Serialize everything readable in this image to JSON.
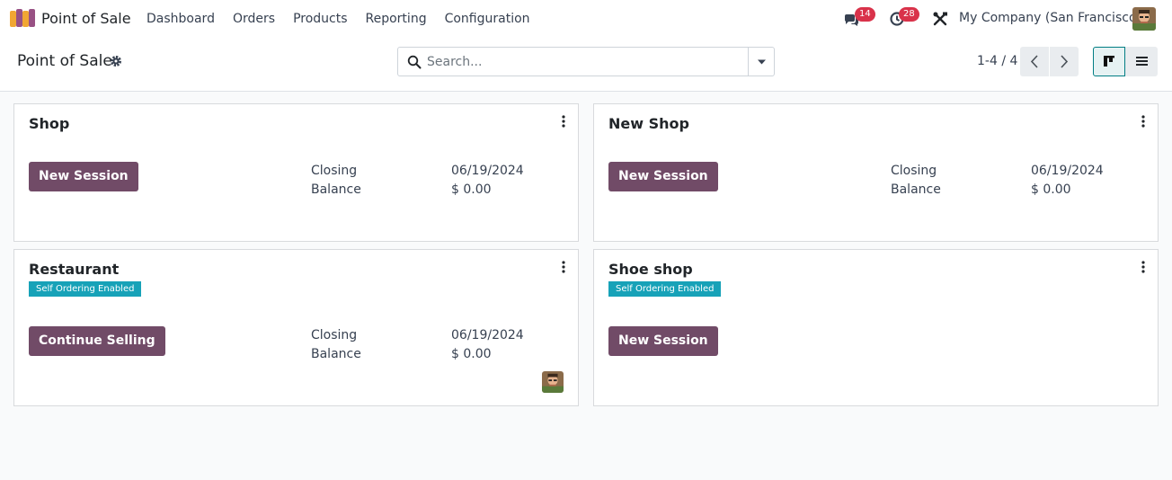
{
  "navbar": {
    "app_name": "Point of Sale",
    "menu": [
      "Dashboard",
      "Orders",
      "Products",
      "Reporting",
      "Configuration"
    ],
    "messages_count": "14",
    "activities_count": "28",
    "company": "My Company (San Francisco)",
    "icons": {
      "app": "pos-app-icon",
      "messages": "chat-icon",
      "activities": "clock-icon",
      "debug": "tools-icon",
      "user": "user-avatar"
    }
  },
  "control_panel": {
    "breadcrumb": "Point of Sale",
    "search_placeholder": "Search...",
    "pager": "1-4 / 4"
  },
  "cards": [
    {
      "title": "Shop",
      "tag": "",
      "button": "New Session",
      "closing_label": "Closing",
      "closing_value": "06/19/2024",
      "balance_label": "Balance",
      "balance_value": "$ 0.00"
    },
    {
      "title": "New Shop",
      "tag": "",
      "button": "New Session",
      "closing_label": "Closing",
      "closing_value": "06/19/2024",
      "balance_label": "Balance",
      "balance_value": "$ 0.00"
    },
    {
      "title": "Restaurant",
      "tag": "Self Ordering Enabled",
      "button": "Continue Selling",
      "closing_label": "Closing",
      "closing_value": "06/19/2024",
      "balance_label": "Balance",
      "balance_value": "$ 0.00"
    },
    {
      "title": "Shoe shop",
      "tag": "Self Ordering Enabled",
      "button": "New Session"
    }
  ],
  "colors": {
    "primary": "#714b67",
    "tag": "#17a2b8",
    "badge": "#d9324a",
    "active_view": "#017e84"
  }
}
